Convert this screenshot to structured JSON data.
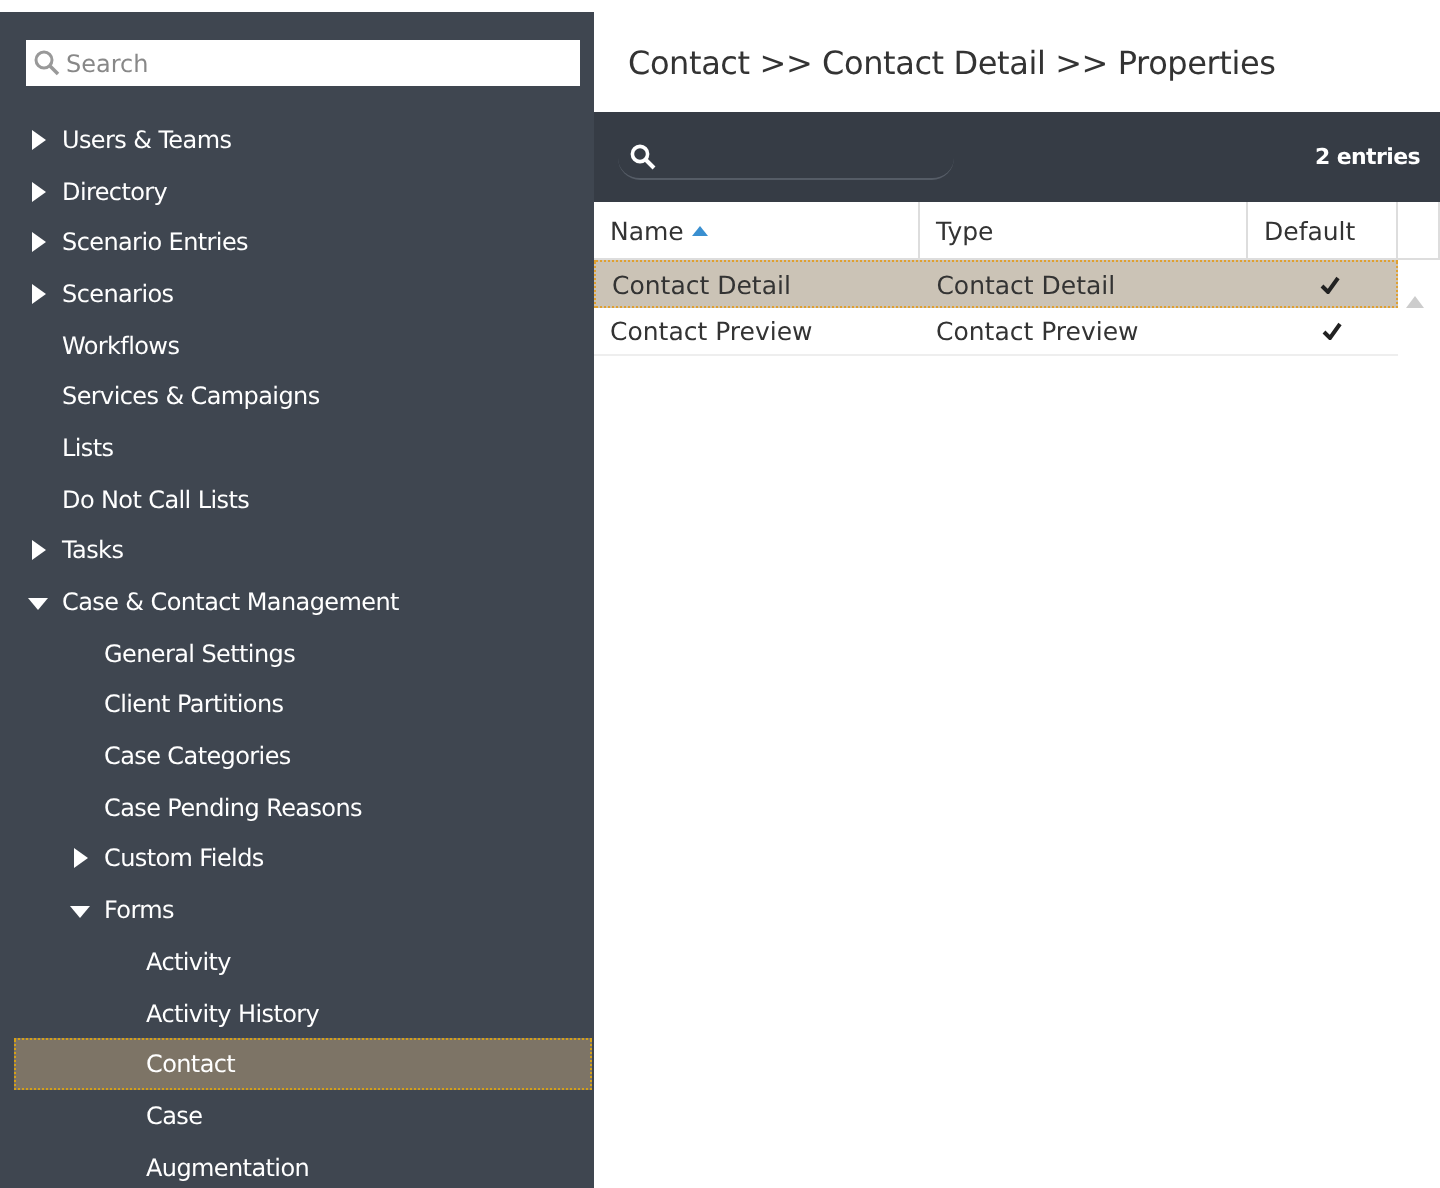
{
  "sidebar": {
    "search": {
      "placeholder": "Search"
    },
    "items": [
      {
        "label": "Users & Teams",
        "expanded": false,
        "selected": false
      },
      {
        "label": "Directory",
        "expanded": false,
        "selected": false
      },
      {
        "label": "Scenario Entries",
        "expanded": false,
        "selected": false
      },
      {
        "label": "Scenarios",
        "expanded": false,
        "selected": false
      },
      {
        "label": "Workflows",
        "selected": false
      },
      {
        "label": "Services & Campaigns",
        "selected": false
      },
      {
        "label": "Lists",
        "selected": false
      },
      {
        "label": "Do Not Call Lists",
        "selected": false
      },
      {
        "label": "Tasks",
        "expanded": false,
        "selected": false
      },
      {
        "label": "Case & Contact Management",
        "expanded": true,
        "selected": false,
        "children": [
          {
            "label": "General Settings",
            "selected": false
          },
          {
            "label": "Client Partitions",
            "selected": false
          },
          {
            "label": "Case Categories",
            "selected": false
          },
          {
            "label": "Case Pending Reasons",
            "selected": false
          },
          {
            "label": "Custom Fields",
            "expanded": false,
            "selected": false
          },
          {
            "label": "Forms",
            "expanded": true,
            "selected": false,
            "children": [
              {
                "label": "Activity",
                "selected": false
              },
              {
                "label": "Activity History",
                "selected": false
              },
              {
                "label": "Contact",
                "selected": true
              },
              {
                "label": "Case",
                "selected": false
              },
              {
                "label": "Augmentation",
                "selected": false
              }
            ]
          }
        ]
      }
    ]
  },
  "main": {
    "title": "Contact >> Contact Detail >> Properties",
    "entries": "2 entries",
    "table": {
      "columns": [
        {
          "label": "Name",
          "sorted": true
        },
        {
          "label": "Type",
          "sorted": false
        },
        {
          "label": "Default",
          "sorted": false
        }
      ],
      "rows": [
        {
          "name": "Contact Detail",
          "type": "Contact Detail",
          "default": true,
          "selected": true
        },
        {
          "name": "Contact Preview",
          "type": "Contact Preview",
          "default": true,
          "selected": false
        }
      ]
    }
  }
}
